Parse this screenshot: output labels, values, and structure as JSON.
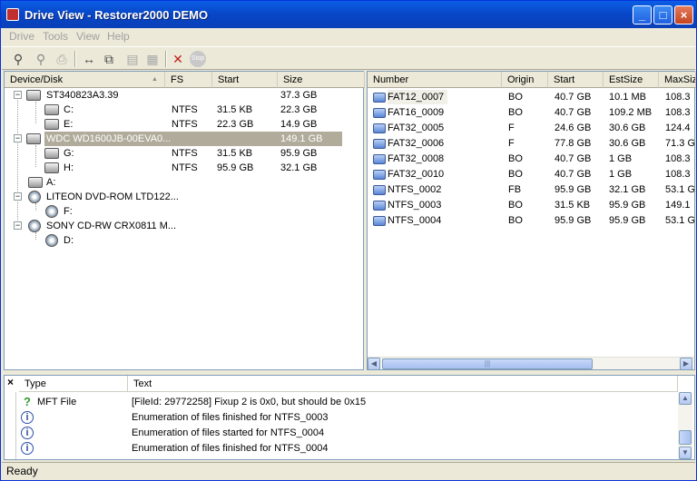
{
  "window": {
    "title": "Drive View - Restorer2000 DEMO",
    "minimize": "_",
    "maximize": "□",
    "close": "×"
  },
  "menu": [
    "Drive",
    "Tools",
    "View",
    "Help"
  ],
  "toolbar": {
    "icons": [
      "search-icon",
      "scan-icon",
      "print-icon",
      "print-preview-icon",
      "arrows-icon",
      "copy-icon",
      "paste-icon",
      "files-icon",
      "delete-icon",
      "stop-icon"
    ]
  },
  "tree": {
    "columns": [
      "Device/Disk",
      "FS",
      "Start",
      "Size"
    ],
    "sort_arrow": "▲",
    "rows": [
      {
        "name": "ST340823A3.39",
        "fs": "",
        "start": "",
        "size": "37.3 GB"
      },
      {
        "name": "C:",
        "fs": "NTFS",
        "start": "31.5 KB",
        "size": "22.3 GB"
      },
      {
        "name": "E:",
        "fs": "NTFS",
        "start": "22.3 GB",
        "size": "14.9 GB"
      },
      {
        "name": "WDC WD1600JB-00EVA0...",
        "fs": "",
        "start": "",
        "size": "149.1 GB"
      },
      {
        "name": "G:",
        "fs": "NTFS",
        "start": "31.5 KB",
        "size": "95.9 GB"
      },
      {
        "name": "H:",
        "fs": "NTFS",
        "start": "95.9 GB",
        "size": "32.1 GB"
      },
      {
        "name": "A:",
        "fs": "",
        "start": "",
        "size": ""
      },
      {
        "name": "LITEON DVD-ROM LTD122...",
        "fs": "",
        "start": "",
        "size": ""
      },
      {
        "name": "F:",
        "fs": "",
        "start": "",
        "size": ""
      },
      {
        "name": "SONY CD-RW CRX0811 M...",
        "fs": "",
        "start": "",
        "size": ""
      },
      {
        "name": "D:",
        "fs": "",
        "start": "",
        "size": ""
      }
    ]
  },
  "partitions": {
    "columns": [
      "Number",
      "Origin",
      "Start",
      "EstSize",
      "MaxSiz"
    ],
    "rows": [
      {
        "number": "FAT12_0007",
        "origin": "BO",
        "start": "40.7 GB",
        "estsize": "10.1 MB",
        "maxsize": "108.3"
      },
      {
        "number": "FAT16_0009",
        "origin": "BO",
        "start": "40.7 GB",
        "estsize": "109.2 MB",
        "maxsize": "108.3"
      },
      {
        "number": "FAT32_0005",
        "origin": "F",
        "start": "24.6 GB",
        "estsize": "30.6 GB",
        "maxsize": "124.4"
      },
      {
        "number": "FAT32_0006",
        "origin": "F",
        "start": "77.8 GB",
        "estsize": "30.6 GB",
        "maxsize": "71.3 G"
      },
      {
        "number": "FAT32_0008",
        "origin": "BO",
        "start": "40.7 GB",
        "estsize": "1 GB",
        "maxsize": "108.3"
      },
      {
        "number": "FAT32_0010",
        "origin": "BO",
        "start": "40.7 GB",
        "estsize": "1 GB",
        "maxsize": "108.3"
      },
      {
        "number": "NTFS_0002",
        "origin": "FB",
        "start": "95.9 GB",
        "estsize": "32.1 GB",
        "maxsize": "53.1 G"
      },
      {
        "number": "NTFS_0003",
        "origin": "BO",
        "start": "31.5 KB",
        "estsize": "95.9 GB",
        "maxsize": "149.1"
      },
      {
        "number": "NTFS_0004",
        "origin": "BO",
        "start": "95.9 GB",
        "estsize": "95.9 GB",
        "maxsize": "53.1 G"
      }
    ]
  },
  "log": {
    "close": "×",
    "columns": [
      "Type",
      "Text"
    ],
    "rows": [
      {
        "icon": "?",
        "type": "MFT File",
        "text": "[FileId: 29772258] Fixup 2 is 0x0, but should be 0x15"
      },
      {
        "icon": "i",
        "type": "",
        "text": "Enumeration of files finished for NTFS_0003"
      },
      {
        "icon": "i",
        "type": "",
        "text": "Enumeration of files started for NTFS_0004"
      },
      {
        "icon": "i",
        "type": "",
        "text": "Enumeration of files finished for NTFS_0004"
      }
    ]
  },
  "status": "Ready"
}
